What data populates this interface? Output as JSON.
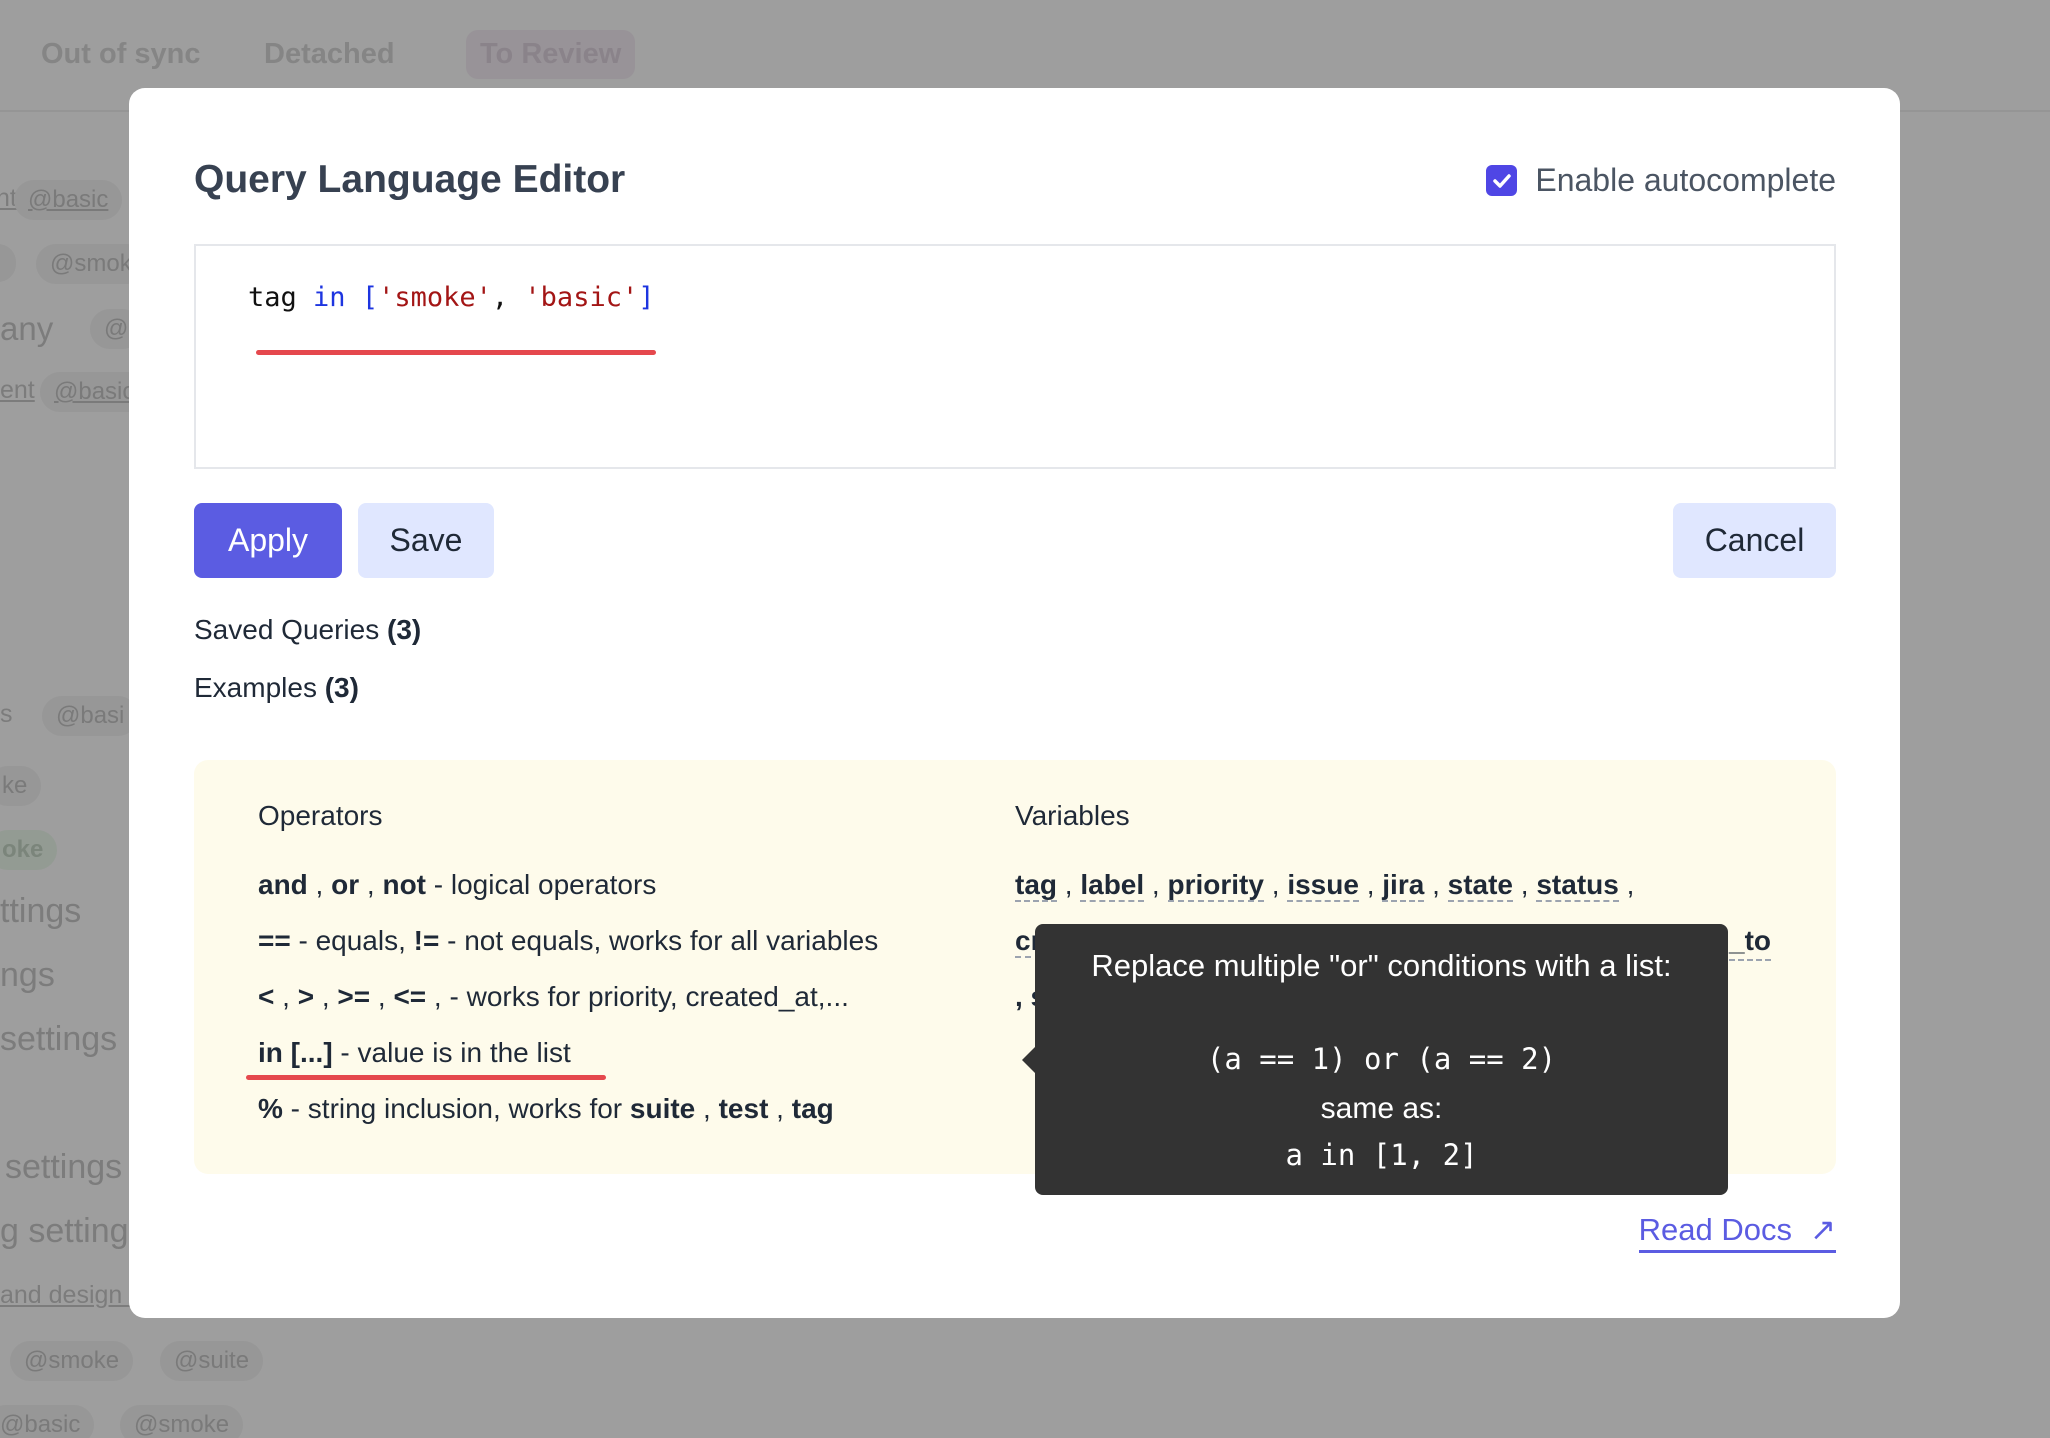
{
  "background": {
    "tabs": [
      "Out of sync",
      "Detached",
      "To Review"
    ],
    "fragments": [
      "nt",
      "@basic",
      "@smok",
      "any",
      "@",
      "ent",
      "@basic",
      "s",
      "@basi",
      "ke",
      "oke",
      "ttings",
      "ngs",
      "settings",
      "settings",
      "g settings",
      "and design -",
      "@smoke",
      "@suite",
      "@basic",
      "@smoke"
    ]
  },
  "modal": {
    "title": "Query Language Editor",
    "autocomplete_label": "Enable autocomplete",
    "autocomplete_checked": true,
    "query": {
      "var": "tag",
      "op": "in",
      "open": "[",
      "s1": "'smoke'",
      "comma": ",",
      "s2": "'basic'",
      "close": "]"
    },
    "buttons": {
      "apply": "Apply",
      "save": "Save",
      "cancel": "Cancel"
    },
    "saved_queries": {
      "label": "Saved Queries",
      "count": "(3)"
    },
    "examples": {
      "label": "Examples",
      "count": "(3)"
    },
    "help": {
      "operators_title": "Operators",
      "operators": [
        {
          "parts": [
            "and",
            " , ",
            "or",
            " , ",
            "not"
          ],
          "desc": " - logical operators"
        },
        {
          "parts": [
            "==",
            " - equals, ",
            "!="
          ],
          "desc": " - not equals, works for all variables"
        },
        {
          "parts": [
            "<",
            " , ",
            ">",
            " , ",
            ">=",
            " , ",
            "<="
          ],
          "desc": " , - works for priority, created_at,..."
        },
        {
          "parts": [
            "in [...]"
          ],
          "desc": " - value is in the list"
        },
        {
          "parts": [
            "%"
          ],
          "desc": " - string inclusion, works for ",
          "extra": [
            "suite",
            "test",
            "tag"
          ]
        }
      ],
      "variables_title": "Variables",
      "variables_line1": [
        "tag",
        "label",
        "priority",
        "issue",
        "jira",
        "state",
        "status"
      ],
      "variables_line2_start": "cr",
      "variables_line2_end": "_to",
      "variables_line3_start": ", s"
    },
    "tooltip": {
      "title": "Replace multiple \"or\" conditions with a list:",
      "code1": "(a == 1) or (a == 2)",
      "same": "same as:",
      "code2": "a in [1, 2]"
    },
    "read_docs": "Read Docs",
    "read_docs_icon": "↗"
  },
  "colors": {
    "accent": "#5b5ce2",
    "annotation": "#e5484d",
    "help_bg": "#fefbeb",
    "tooltip_bg": "#333333"
  }
}
